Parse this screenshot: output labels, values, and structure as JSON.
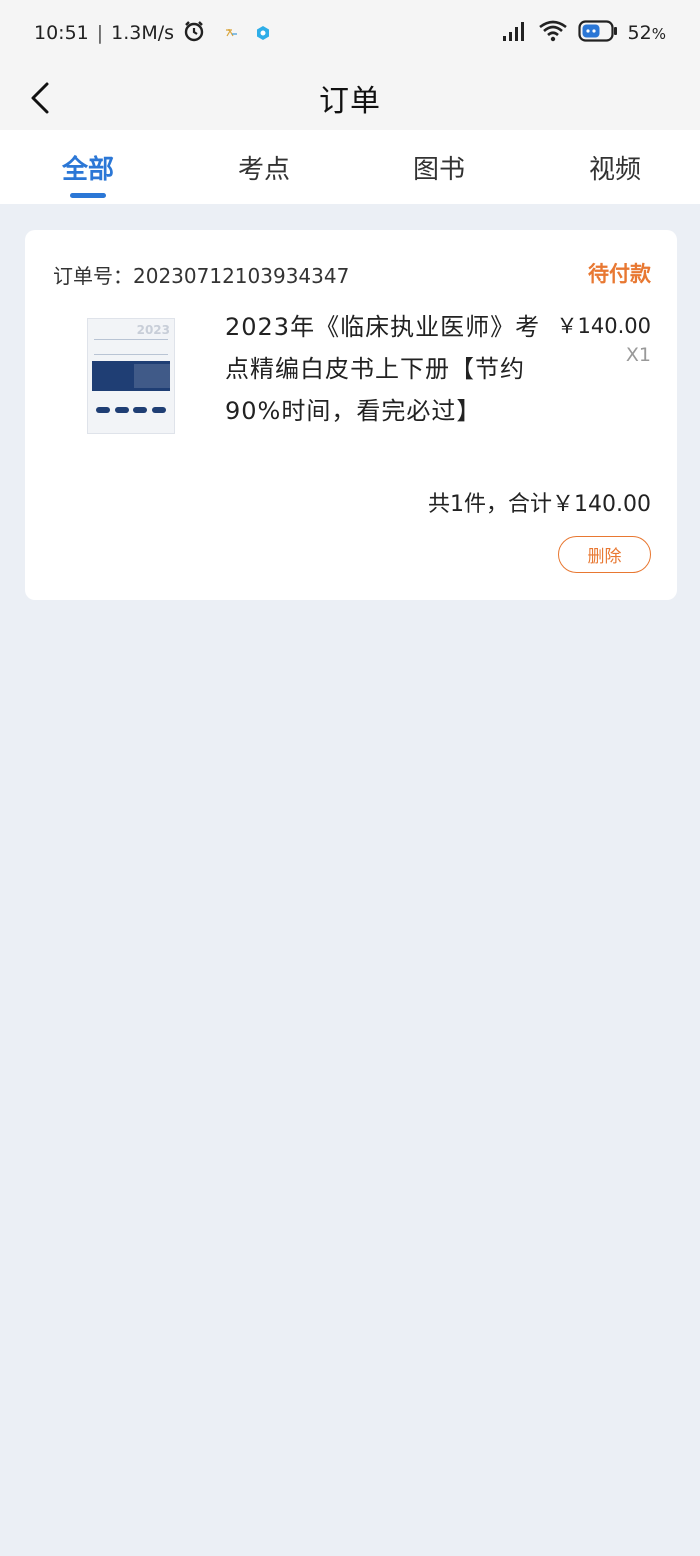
{
  "status_bar": {
    "time": "10:51",
    "separator": "|",
    "net_speed": "1.3M/s",
    "battery": "52",
    "battery_unit": "%"
  },
  "nav": {
    "title": "订单"
  },
  "tabs": [
    {
      "label": "全部",
      "active": true
    },
    {
      "label": "考点",
      "active": false
    },
    {
      "label": "图书",
      "active": false
    },
    {
      "label": "视频",
      "active": false
    }
  ],
  "order": {
    "order_no": "订单号：20230712103934347",
    "status": "待付款",
    "cover_year": "2023",
    "title": "2023年《临床执业医师》考点精编白皮书上下册【节约90%时间，看完必过】",
    "price": "￥140.00",
    "qty": "X1",
    "total": "共1件，合计￥140.00",
    "delete_label": "删除"
  },
  "colors": {
    "accent_blue": "#2b77d6",
    "status_orange": "#e87832",
    "page_bg": "#ebeff5"
  }
}
